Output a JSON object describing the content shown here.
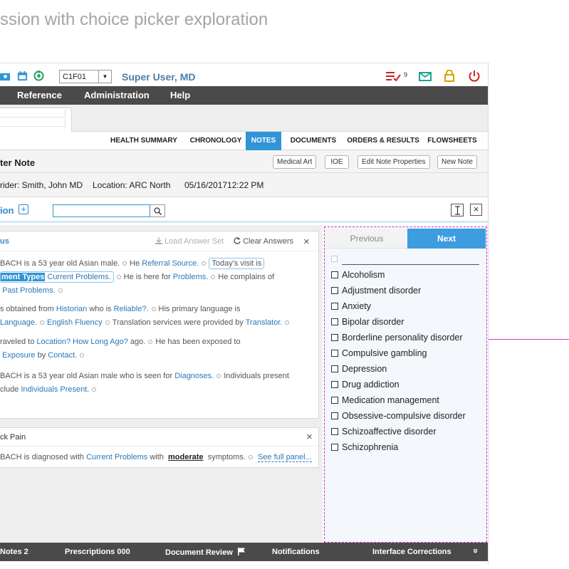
{
  "page": {
    "heading": "ssion with choice picker exploration"
  },
  "topbar": {
    "station": "C1F01",
    "station_arrow": "▼",
    "user": "Super User, MD",
    "tasks_count": "9",
    "colors": {
      "accent": "#2f95d6",
      "user": "#4e7ea6",
      "alert": "#cc2222",
      "mail": "#1aa390",
      "lock": "#d6a200"
    },
    "icons": [
      "patients-icon",
      "calendar-icon",
      "refresh-icon",
      "tasks-icon",
      "mail-icon",
      "lock-icon",
      "power-icon"
    ]
  },
  "menu": {
    "items": [
      "Reference",
      "Administration",
      "Help"
    ]
  },
  "nav_tabs": [
    "HEALTH SUMMARY",
    "CHRONOLOGY",
    "NOTES",
    "DOCUMENTS",
    "ORDERS & RESULTS",
    "FLOWSHEETS"
  ],
  "note": {
    "title": "ter Note",
    "buttons": [
      "Medical Art",
      "IOE",
      "Edit Note Properties",
      "New Note"
    ],
    "provider": "rider: Smith, John MD",
    "location": "Location: ARC North",
    "datetime": "05/16/201712:22 PM"
  },
  "section": {
    "label": "ion",
    "search_value": ""
  },
  "panel1": {
    "title": "us",
    "load_answer_set": "Load Answer Set",
    "clear_answers": "Clear Answers",
    "close": "×",
    "s1": "BACH is a 53 year old Asian male.",
    "s2": "He",
    "s3": "Referral Source.",
    "s4": "Today's visit is",
    "s5": "ment Types",
    "s6": "Current Problems.",
    "s7": "He is here for",
    "s8": "Problems.",
    "s9": "He complains of",
    "s10": "Past Problems.",
    "s11": "s obtained from",
    "s12": "Historian",
    "s13": "who is",
    "s14": "Reliable?.",
    "s15": "His primary language is",
    "s16": "Language.",
    "s17": "English Fluency",
    "s18": "Translation services were provided by",
    "s19": "Translator.",
    "s20": "raveled to",
    "s21": "Location?",
    "s22": "How Long Ago?",
    "s23": "ago.",
    "s24": "He has been exposed to",
    "s25": "Exposure",
    "s26": "by",
    "s27": "Contact.",
    "s28": "BACH is a 53 year old Asian male who is seen for",
    "s29": "Diagnoses.",
    "s30": "Individuals present",
    "s31": "clude",
    "s32": "Individuals Present."
  },
  "panel2": {
    "title": "ck Pain",
    "close": "×",
    "t1": "BACH is diagnosed with",
    "t2": "Current Problems",
    "t3": "with",
    "t4": "moderate",
    "t5": "symptoms.",
    "t6": "See full panel..."
  },
  "picker": {
    "prev": "Previous",
    "next": "Next",
    "choices": [
      "Alcoholism",
      "Adjustment disorder",
      "Anxiety",
      "Bipolar disorder",
      "Borderline personality disorder",
      "Compulsive gambling",
      "Depression",
      "Drug addiction",
      "Medication management",
      "Obsessive-compulsive disorder",
      "Schizoaffective disorder",
      "Schizophrenia"
    ]
  },
  "status": {
    "items": [
      "Notes 2",
      "Prescriptions 000",
      "Document Review",
      "Notifications",
      "Interface Corrections"
    ],
    "expand": "»"
  }
}
